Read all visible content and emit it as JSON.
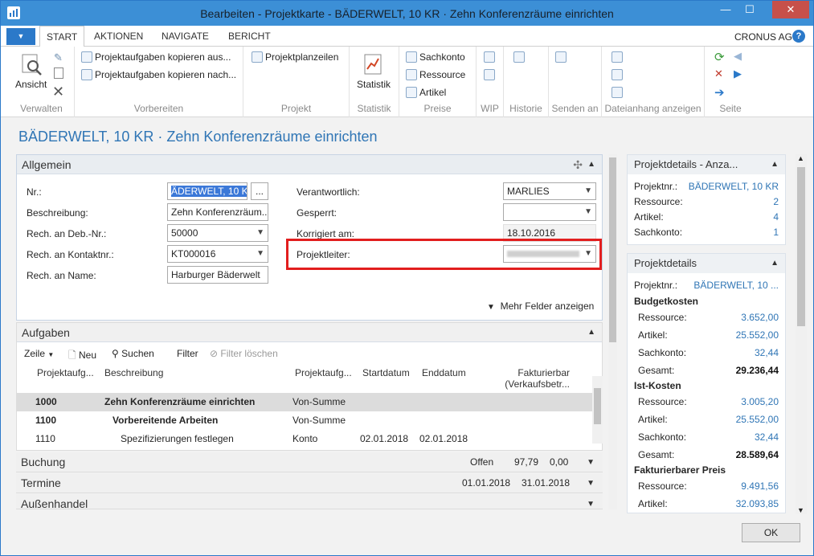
{
  "window": {
    "title": "Bearbeiten - Projektkarte - BÄDERWELT, 10 KR · Zehn Konferenzräume einrichten"
  },
  "ribbon_tabs": [
    "START",
    "AKTIONEN",
    "NAVIGATE",
    "BERICHT"
  ],
  "company": "CRONUS AG",
  "ribbon": {
    "verwalten": {
      "label": "Verwalten",
      "ansicht": "Ansicht"
    },
    "vorbereiten": {
      "label": "Vorbereiten",
      "kopieren_aus": "Projektaufgaben kopieren aus...",
      "kopieren_nach": "Projektaufgaben kopieren nach..."
    },
    "projekt": {
      "label": "Projekt",
      "planzeilen": "Projektplanzeilen"
    },
    "statistik": {
      "label": "Statistik",
      "button": "Statistik"
    },
    "preise": {
      "label": "Preise",
      "sachkonto": "Sachkonto",
      "ressource": "Ressource",
      "artikel": "Artikel"
    },
    "wip": {
      "label": "WIP"
    },
    "historie": {
      "label": "Historie"
    },
    "senden": {
      "label": "Senden an"
    },
    "dateianhang": {
      "label": "Dateianhang anzeigen"
    },
    "seite": {
      "label": "Seite"
    }
  },
  "page_heading": "BÄDERWELT, 10 KR · Zehn Konferenzräume einrichten",
  "allgemein": {
    "title": "Allgemein",
    "nr_label": "Nr.:",
    "nr_value": "ÄDERWELT, 10 KR",
    "beschreibung_label": "Beschreibung:",
    "beschreibung_value": "Zehn Konferenzräum...",
    "deb_label": "Rech. an Deb.-Nr.:",
    "deb_value": "50000",
    "kontakt_label": "Rech. an Kontaktnr.:",
    "kontakt_value": "KT000016",
    "name_label": "Rech. an Name:",
    "name_value": "Harburger Bäderwelt",
    "verantwortlich_label": "Verantwortlich:",
    "verantwortlich_value": "MARLIES",
    "gesperrt_label": "Gesperrt:",
    "gesperrt_value": "",
    "korrigiert_label": "Korrigiert am:",
    "korrigiert_value": "18.10.2016",
    "projektleiter_label": "Projektleiter:",
    "mehr_felder": "Mehr Felder anzeigen"
  },
  "aufgaben": {
    "title": "Aufgaben",
    "toolbar": {
      "zeile": "Zeile",
      "neu": "Neu",
      "suchen": "Suchen",
      "filter": "Filter",
      "filter_loeschen": "Filter löschen"
    },
    "columns": [
      "Projektaufg...",
      "Beschreibung",
      "Projektaufg...",
      "Startdatum",
      "Enddatum",
      "Fakturierbar (Verkaufsbetr..."
    ],
    "rows": [
      {
        "nr": "1000",
        "beschreibung": "Zehn Konferenzräume einrichten",
        "art": "Von-Summe",
        "start": "",
        "ende": ""
      },
      {
        "nr": "1100",
        "beschreibung": "Vorbereitende Arbeiten",
        "art": "Von-Summe",
        "start": "",
        "ende": ""
      },
      {
        "nr": "1110",
        "beschreibung": "Spezifizierungen festlegen",
        "art": "Konto",
        "start": "02.01.2018",
        "ende": "02.01.2018"
      }
    ]
  },
  "buchung": {
    "title": "Buchung",
    "v1": "Offen",
    "v2": "97,79",
    "v3": "0,00"
  },
  "termine": {
    "title": "Termine",
    "v1": "01.01.2018",
    "v2": "31.01.2018"
  },
  "aussenhandel": {
    "title": "Außenhandel"
  },
  "factbox1": {
    "title": "Projektdetails - Anza...",
    "rows": [
      {
        "k": "Projektnr.:",
        "v": "BÄDERWELT, 10 KR"
      },
      {
        "k": "Ressource:",
        "v": "2"
      },
      {
        "k": "Artikel:",
        "v": "4"
      },
      {
        "k": "Sachkonto:",
        "v": "1"
      }
    ]
  },
  "factbox2": {
    "title": "Projektdetails",
    "projektnr_k": "Projektnr.:",
    "projektnr_v": "BÄDERWELT, 10 ...",
    "budget_title": "Budgetkosten",
    "budget": [
      {
        "k": "Ressource:",
        "v": "3.652,00"
      },
      {
        "k": "Artikel:",
        "v": "25.552,00"
      },
      {
        "k": "Sachkonto:",
        "v": "32,44"
      },
      {
        "k": "Gesamt:",
        "v": "29.236,44"
      }
    ],
    "ist_title": "Ist-Kosten",
    "ist": [
      {
        "k": "Ressource:",
        "v": "3.005,20"
      },
      {
        "k": "Artikel:",
        "v": "25.552,00"
      },
      {
        "k": "Sachkonto:",
        "v": "32,44"
      },
      {
        "k": "Gesamt:",
        "v": "28.589,64"
      }
    ],
    "fakt_title": "Fakturierbarer Preis",
    "fakt": [
      {
        "k": "Ressource:",
        "v": "9.491,56"
      },
      {
        "k": "Artikel:",
        "v": "32.093,85"
      }
    ]
  },
  "ok_label": "OK",
  "colors": {
    "accent": "#2b79c9",
    "link": "#2f75b5",
    "highlight": "#e21e1e"
  }
}
